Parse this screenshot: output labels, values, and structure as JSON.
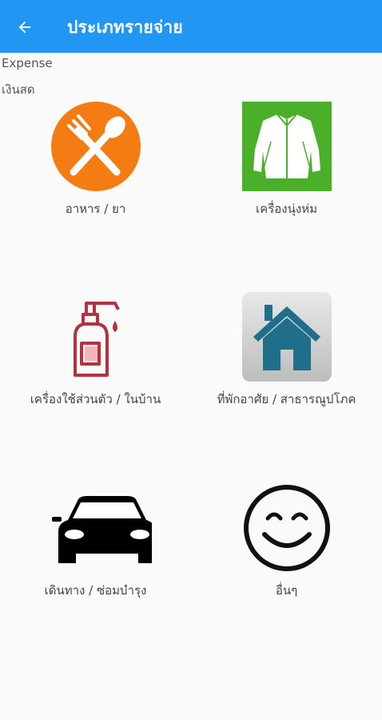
{
  "appbar": {
    "title": "ประเภทรายจ่าย",
    "back_icon": "arrow-left-icon"
  },
  "subheader": {
    "type_label": "Expense",
    "payment_label": "เงินสด"
  },
  "categories": [
    {
      "label": "อาหาร / ยา",
      "icon": "fork-spoon-icon",
      "color": "#f47c12"
    },
    {
      "label": "เครื่องนุ่งห่ม",
      "icon": "shirt-icon",
      "color": "#4caf2a"
    },
    {
      "label": "เครื่องใช้ส่วนตัว / ในบ้าน",
      "icon": "soap-bottle-icon",
      "color": "#b1333f"
    },
    {
      "label": "ที่พักอาศัย / สาธารณูปโภค",
      "icon": "house-icon",
      "color": "#1f6f8b"
    },
    {
      "label": "เดินทาง / ซ่อมบำรุง",
      "icon": "car-icon",
      "color": "#000000"
    },
    {
      "label": "อื่นๆ",
      "icon": "smiley-icon",
      "color": "#111111"
    }
  ],
  "colors": {
    "appbar": "#2196f3",
    "background": "#fafafa"
  }
}
